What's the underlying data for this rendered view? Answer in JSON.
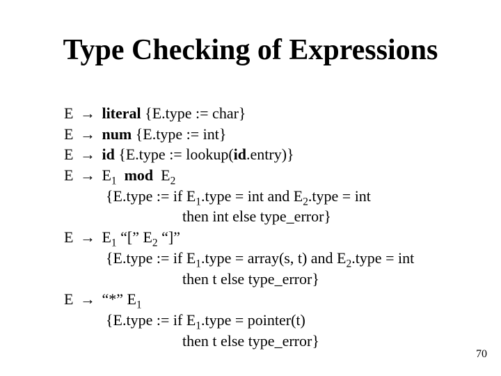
{
  "title": "Type Checking of Expressions",
  "rules": {
    "r1": {
      "lhs": "E",
      "arrow": "→",
      "kw": "literal",
      "rhs_after": "  {E.type := char}"
    },
    "r2": {
      "lhs": "E",
      "arrow": "→",
      "kw": "num",
      "rhs_after": "   {E.type := int}"
    },
    "r3": {
      "lhs": "E",
      "arrow": "→",
      "kw": "id",
      "rhs_after": "   {E.type := lookup(",
      "kw2": "id",
      "tail": ".entry)}"
    },
    "r4": {
      "lhs": "E",
      "arrow": "→",
      "e1": "E",
      "s1": "1",
      "mod": "mod",
      "e2": "E",
      "s2": "2",
      "line2a": "{E.type := if E",
      "line2b": ".type = int and E",
      "line2c": ".type = int",
      "line3": "then int else type_error}"
    },
    "r5": {
      "lhs": "E",
      "arrow": "→",
      "e1": "E",
      "s1": "1",
      "lb": " “[”  ",
      "e2": "E",
      "s2": "2",
      "rb": "  “]”",
      "line2a": "{E.type := if E",
      "line2b": ".type = array(s, t) and E",
      "line2c": ".type = int",
      "line3": "then t else type_error}"
    },
    "r6": {
      "lhs": "E",
      "arrow": "→",
      "star": "“*”  ",
      "e1": "E",
      "s1": "1",
      "line2a": "{E.type := if E",
      "line2b": ".type = pointer(t)",
      "line3": "then t else type_error}"
    }
  },
  "page_number": "70"
}
